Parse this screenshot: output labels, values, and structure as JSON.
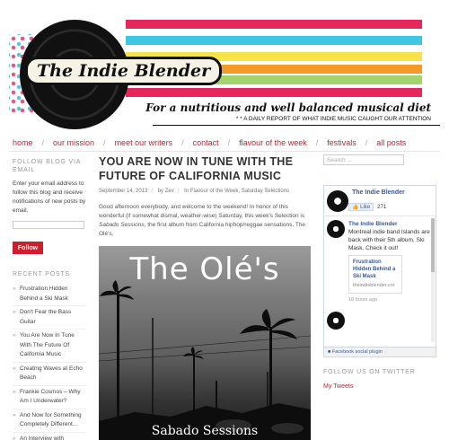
{
  "header": {
    "site_title": "The Indie Blender",
    "tagline": "For a nutritious and well balanced musical diet",
    "subtag": "* * A DAILY REPORT OF WHAT INDIE MUSIC CAUGHT OUR ATTENTION",
    "stripe_colors": [
      "#e6275b",
      "#3fc6e0",
      "#f6e24a",
      "#f39a2a",
      "#a3d36b",
      "#e6275b"
    ]
  },
  "nav": {
    "items": [
      "home",
      "our mission",
      "meet our writers",
      "contact",
      "flavour of the week",
      "festivals",
      "all posts"
    ]
  },
  "left_sidebar": {
    "follow_title": "FOLLOW BLOG VIA EMAIL",
    "follow_text": "Enter your email address to follow this blog and receive notifications of new posts by email.",
    "email_placeholder": "",
    "follow_button": "Follow",
    "recent_title": "RECENT POSTS",
    "recent_posts": [
      "Frustration Hidden Behind a Ski Mask",
      "Don't Fear the Bass Guitar",
      "You Are Now In Tune With The Future Of California Music",
      "Creating Waves at Echo Beach",
      "Frankie Cosmos – Why Am I Underwater?",
      "And Now for Something Completely Different…",
      "An Interview with"
    ]
  },
  "post": {
    "title": "YOU ARE NOW IN TUNE WITH THE FUTURE OF CALIFORNIA MUSIC",
    "date": "September 14, 2013",
    "by": "by",
    "author": "Zev",
    "in": "In",
    "categories": "Flavour of the Week, Saturday Selections",
    "body_before": "Good afternoon everybody, and welcome to the weekend! In honor of this wonderful (if somewhat dismal, weather-wise) Saturday, this week's Selection is ",
    "body_em": "Sabado Sessions",
    "body_after": ", the first album from California hiphop/reggae sensations, The Olé's.",
    "cover_title": "The Olé's",
    "cover_subtitle": "Sabado Sessions"
  },
  "right_sidebar": {
    "search_placeholder": "Search ...",
    "fb": {
      "page_name": "The Indie Blender",
      "like_label": "Like",
      "like_count": "271",
      "post_name": "The Indie Blender",
      "post_text": "Montreal indie band Islands are back with their 5th album, Ski Mask. Check it out!",
      "card_title": "Frustration Hidden Behind a Ski Mask",
      "card_url": "theindieblender.cor",
      "time": "10 hours ago",
      "footer": "Facebook social plugin"
    },
    "twitter_title": "FOLLOW US ON TWITTER",
    "twitter_link": "My Tweets"
  }
}
